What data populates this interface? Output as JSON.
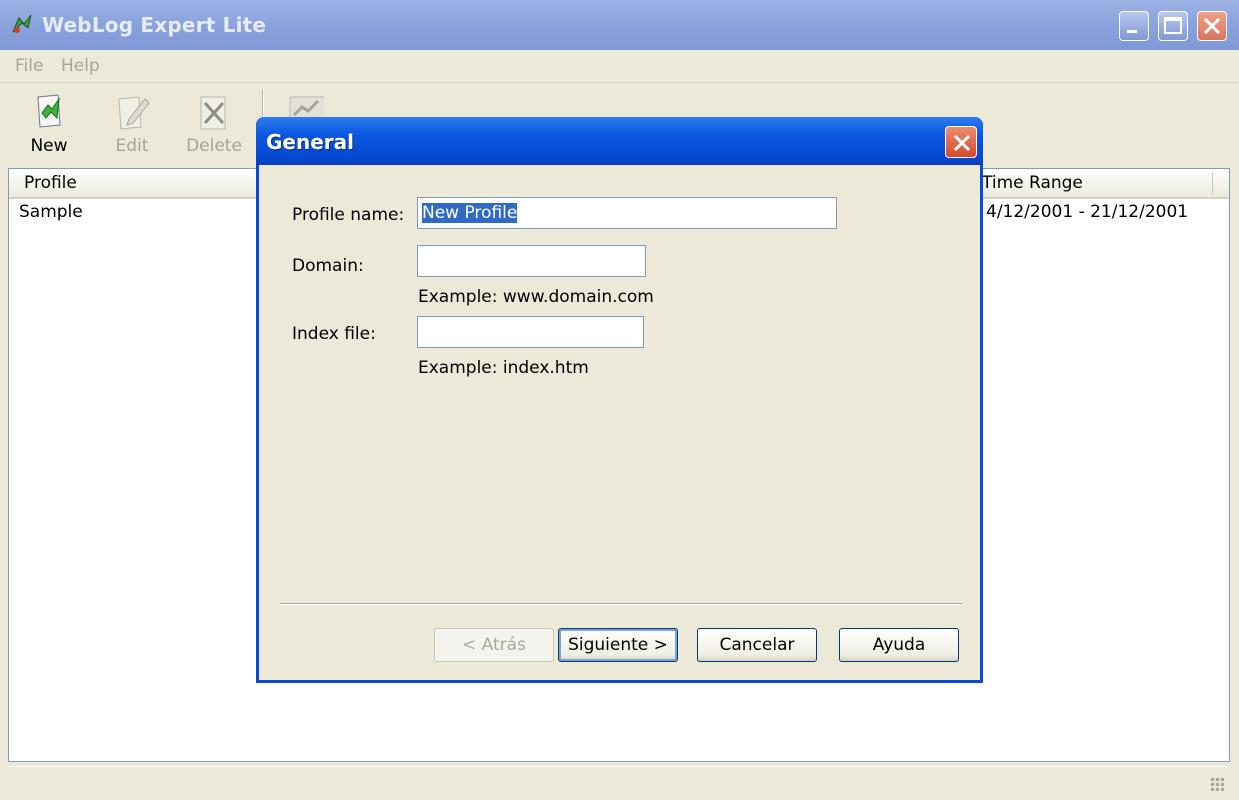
{
  "window": {
    "title": "WebLog Expert Lite"
  },
  "menu": [
    {
      "label": "File"
    },
    {
      "label": "Help"
    }
  ],
  "toolbar": [
    {
      "label": "New",
      "icon": "new-profile-icon",
      "enabled": true
    },
    {
      "label": "Edit",
      "icon": "edit-icon",
      "enabled": false
    },
    {
      "label": "Delete",
      "icon": "delete-icon",
      "enabled": false
    }
  ],
  "list": {
    "columns": {
      "profile": "Profile",
      "time_range": "Time Range"
    },
    "rows": [
      {
        "profile": "Sample",
        "time_range": "4/12/2001 - 21/12/2001"
      }
    ]
  },
  "dialog": {
    "title": "General",
    "fields": {
      "profile_name": {
        "label": "Profile name:",
        "value": "New Profile"
      },
      "domain": {
        "label": "Domain:",
        "value": "",
        "hint": "Example: www.domain.com"
      },
      "index_file": {
        "label": "Index file:",
        "value": "",
        "hint": "Example: index.htm"
      }
    },
    "buttons": {
      "back": "< Atrás",
      "next": "Siguiente >",
      "cancel": "Cancelar",
      "help": "Ayuda"
    }
  },
  "colors": {
    "dialog_title": "#0a55e0",
    "selection": "#316ac5",
    "face": "#ece9d8"
  }
}
